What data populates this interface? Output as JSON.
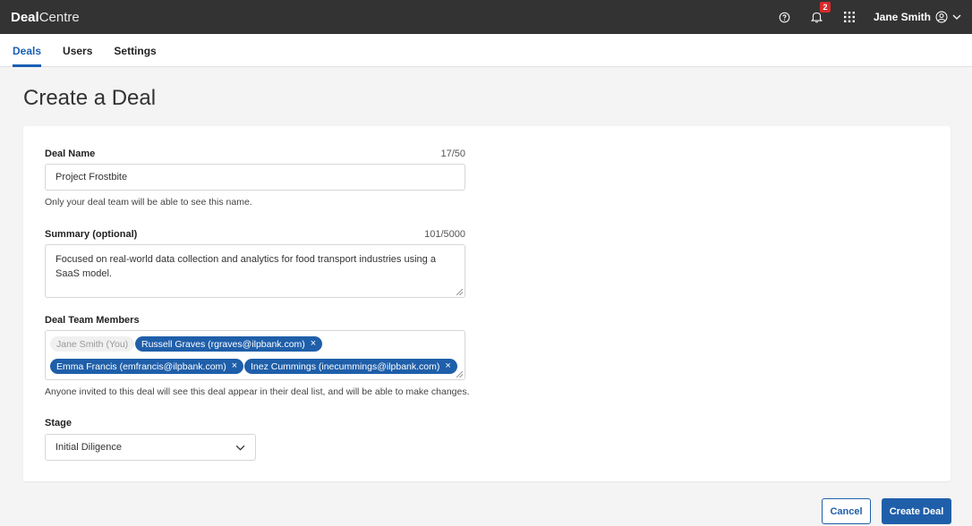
{
  "app": {
    "brand_bold": "Deal",
    "brand_rest": "Centre",
    "notification_count": "2",
    "user_name": "Jane Smith"
  },
  "tabs": [
    {
      "label": "Deals",
      "active": true
    },
    {
      "label": "Users",
      "active": false
    },
    {
      "label": "Settings",
      "active": false
    }
  ],
  "page": {
    "title": "Create a Deal"
  },
  "form": {
    "deal_name": {
      "label": "Deal Name",
      "counter": "17/50",
      "value": "Project Frostbite",
      "help": "Only your deal team will be able to see this name."
    },
    "summary": {
      "label": "Summary (optional)",
      "counter": "101/5000",
      "value": "Focused on real-world data collection and analytics for food transport industries using a SaaS model."
    },
    "team": {
      "label": "Deal Team Members",
      "you": "Jane Smith (You)",
      "members": [
        "Russell Graves (rgraves@ilpbank.com)",
        "Emma Francis (emfrancis@ilpbank.com)",
        "Inez Cummings (inecummings@ilpbank.com)"
      ],
      "remove_glyph": "×",
      "help": "Anyone invited to this deal will see this deal appear in their deal list, and will be able to make changes."
    },
    "stage": {
      "label": "Stage",
      "value": "Initial Diligence"
    }
  },
  "actions": {
    "cancel": "Cancel",
    "create": "Create Deal"
  },
  "colors": {
    "topbar": "#333333",
    "accent": "#1f5faa",
    "badge": "#d62b2b"
  },
  "icons": [
    "help-circle-icon",
    "bell-icon",
    "apps-grid-icon",
    "user-circle-icon",
    "chevron-down-icon",
    "close-icon"
  ]
}
